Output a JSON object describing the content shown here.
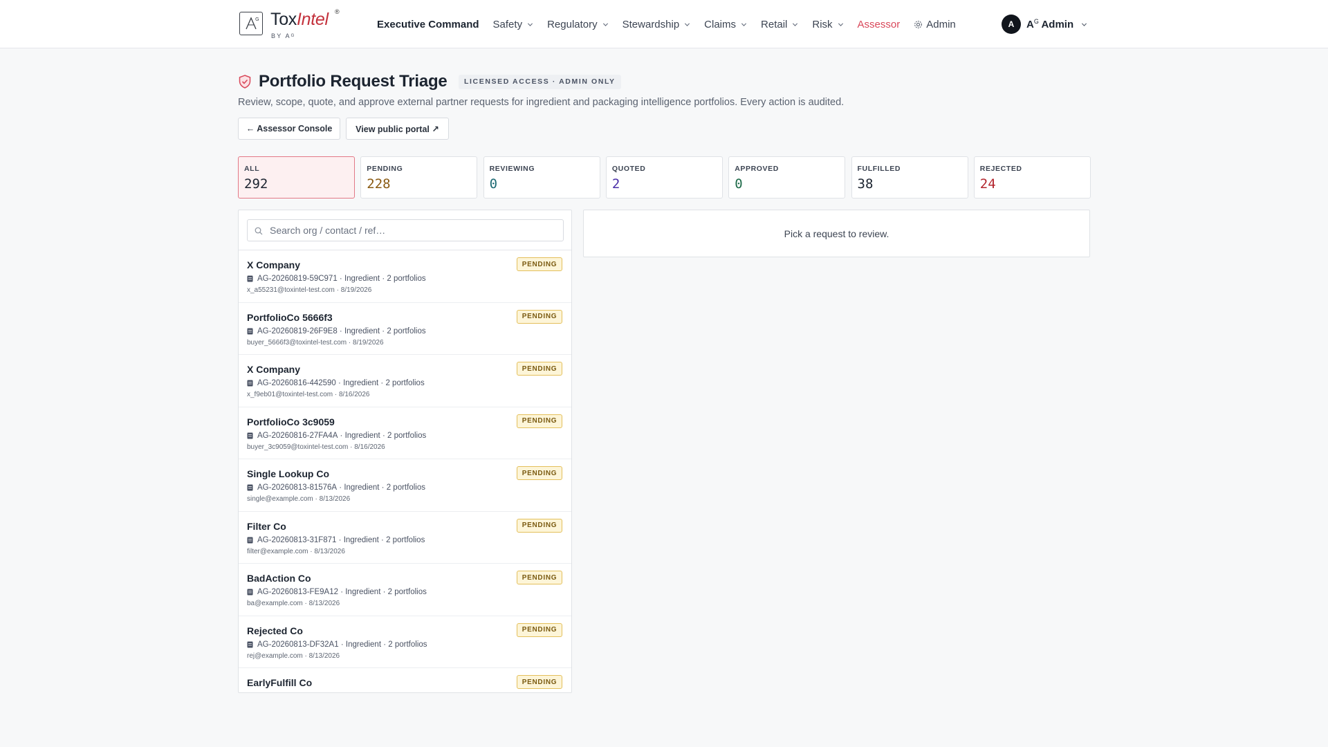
{
  "brand": {
    "name_plain": "Tox",
    "name_accent": "Intel",
    "registered": "®",
    "byline": "BY Aᴳ",
    "mark_letter": "A"
  },
  "nav": {
    "items": [
      {
        "label": "Executive Command",
        "style": "bold",
        "chevron": false
      },
      {
        "label": "Safety",
        "chevron": true
      },
      {
        "label": "Regulatory",
        "chevron": true
      },
      {
        "label": "Stewardship",
        "chevron": true
      },
      {
        "label": "Claims",
        "chevron": true
      },
      {
        "label": "Retail",
        "chevron": true
      },
      {
        "label": "Risk",
        "chevron": true
      },
      {
        "label": "Assessor",
        "style": "accent",
        "chevron": false
      },
      {
        "label": "Admin",
        "icon": "gear-icon",
        "chevron": false
      }
    ]
  },
  "user": {
    "initial": "A",
    "name_prefix": "A",
    "name_sup": "G",
    "name_suffix": " Admin"
  },
  "header": {
    "title": "Portfolio Request Triage",
    "badge": "LICENSED ACCESS · ADMIN ONLY",
    "subtitle": "Review, scope, quote, and approve external partner requests for ingredient and packaging intelligence portfolios. Every action is audited.",
    "back_button": "← Assessor Console",
    "portal_button": "View public portal ↗"
  },
  "stats": [
    {
      "label": "ALL",
      "value": "292",
      "color": "#1c2430",
      "active": true
    },
    {
      "label": "PENDING",
      "value": "228",
      "color": "#8a5a12",
      "active": false
    },
    {
      "label": "REVIEWING",
      "value": "0",
      "color": "#1d6a73",
      "active": false
    },
    {
      "label": "QUOTED",
      "value": "2",
      "color": "#4a2fa8",
      "active": false
    },
    {
      "label": "APPROVED",
      "value": "0",
      "color": "#1f6b4a",
      "active": false
    },
    {
      "label": "FULFILLED",
      "value": "38",
      "color": "#1c2430",
      "active": false
    },
    {
      "label": "REJECTED",
      "value": "24",
      "color": "#b3262e",
      "active": false
    }
  ],
  "search": {
    "placeholder": "Search org / contact / ref…"
  },
  "requests": [
    {
      "org": "X Company",
      "ref": "AG-20260819-59C971",
      "type": "Ingredient",
      "portfolios": "2 portfolios",
      "email": "x_a55231@toxintel-test.com",
      "date": "8/19/2026",
      "status": "PENDING"
    },
    {
      "org": "PortfolioCo 5666f3",
      "ref": "AG-20260819-26F9E8",
      "type": "Ingredient",
      "portfolios": "2 portfolios",
      "email": "buyer_5666f3@toxintel-test.com",
      "date": "8/19/2026",
      "status": "PENDING"
    },
    {
      "org": "X Company",
      "ref": "AG-20260816-442590",
      "type": "Ingredient",
      "portfolios": "2 portfolios",
      "email": "x_f9eb01@toxintel-test.com",
      "date": "8/16/2026",
      "status": "PENDING"
    },
    {
      "org": "PortfolioCo 3c9059",
      "ref": "AG-20260816-27FA4A",
      "type": "Ingredient",
      "portfolios": "2 portfolios",
      "email": "buyer_3c9059@toxintel-test.com",
      "date": "8/16/2026",
      "status": "PENDING"
    },
    {
      "org": "Single Lookup Co",
      "ref": "AG-20260813-81576A",
      "type": "Ingredient",
      "portfolios": "2 portfolios",
      "email": "single@example.com",
      "date": "8/13/2026",
      "status": "PENDING"
    },
    {
      "org": "Filter Co",
      "ref": "AG-20260813-31F871",
      "type": "Ingredient",
      "portfolios": "2 portfolios",
      "email": "filter@example.com",
      "date": "8/13/2026",
      "status": "PENDING"
    },
    {
      "org": "BadAction Co",
      "ref": "AG-20260813-FE9A12",
      "type": "Ingredient",
      "portfolios": "2 portfolios",
      "email": "ba@example.com",
      "date": "8/13/2026",
      "status": "PENDING"
    },
    {
      "org": "Rejected Co",
      "ref": "AG-20260813-DF32A1",
      "type": "Ingredient",
      "portfolios": "2 portfolios",
      "email": "rej@example.com",
      "date": "8/13/2026",
      "status": "PENDING"
    },
    {
      "org": "EarlyFulfill Co",
      "ref": "",
      "type": "",
      "portfolios": "",
      "email": "",
      "date": "",
      "status": "PENDING"
    }
  ],
  "detail": {
    "empty_text": "Pick a request to review."
  },
  "colors": {
    "accent": "#d9485a",
    "brand_red": "#c3303b",
    "pending_bg": "#fdf5d8",
    "pending_border": "#e3bf5a"
  }
}
